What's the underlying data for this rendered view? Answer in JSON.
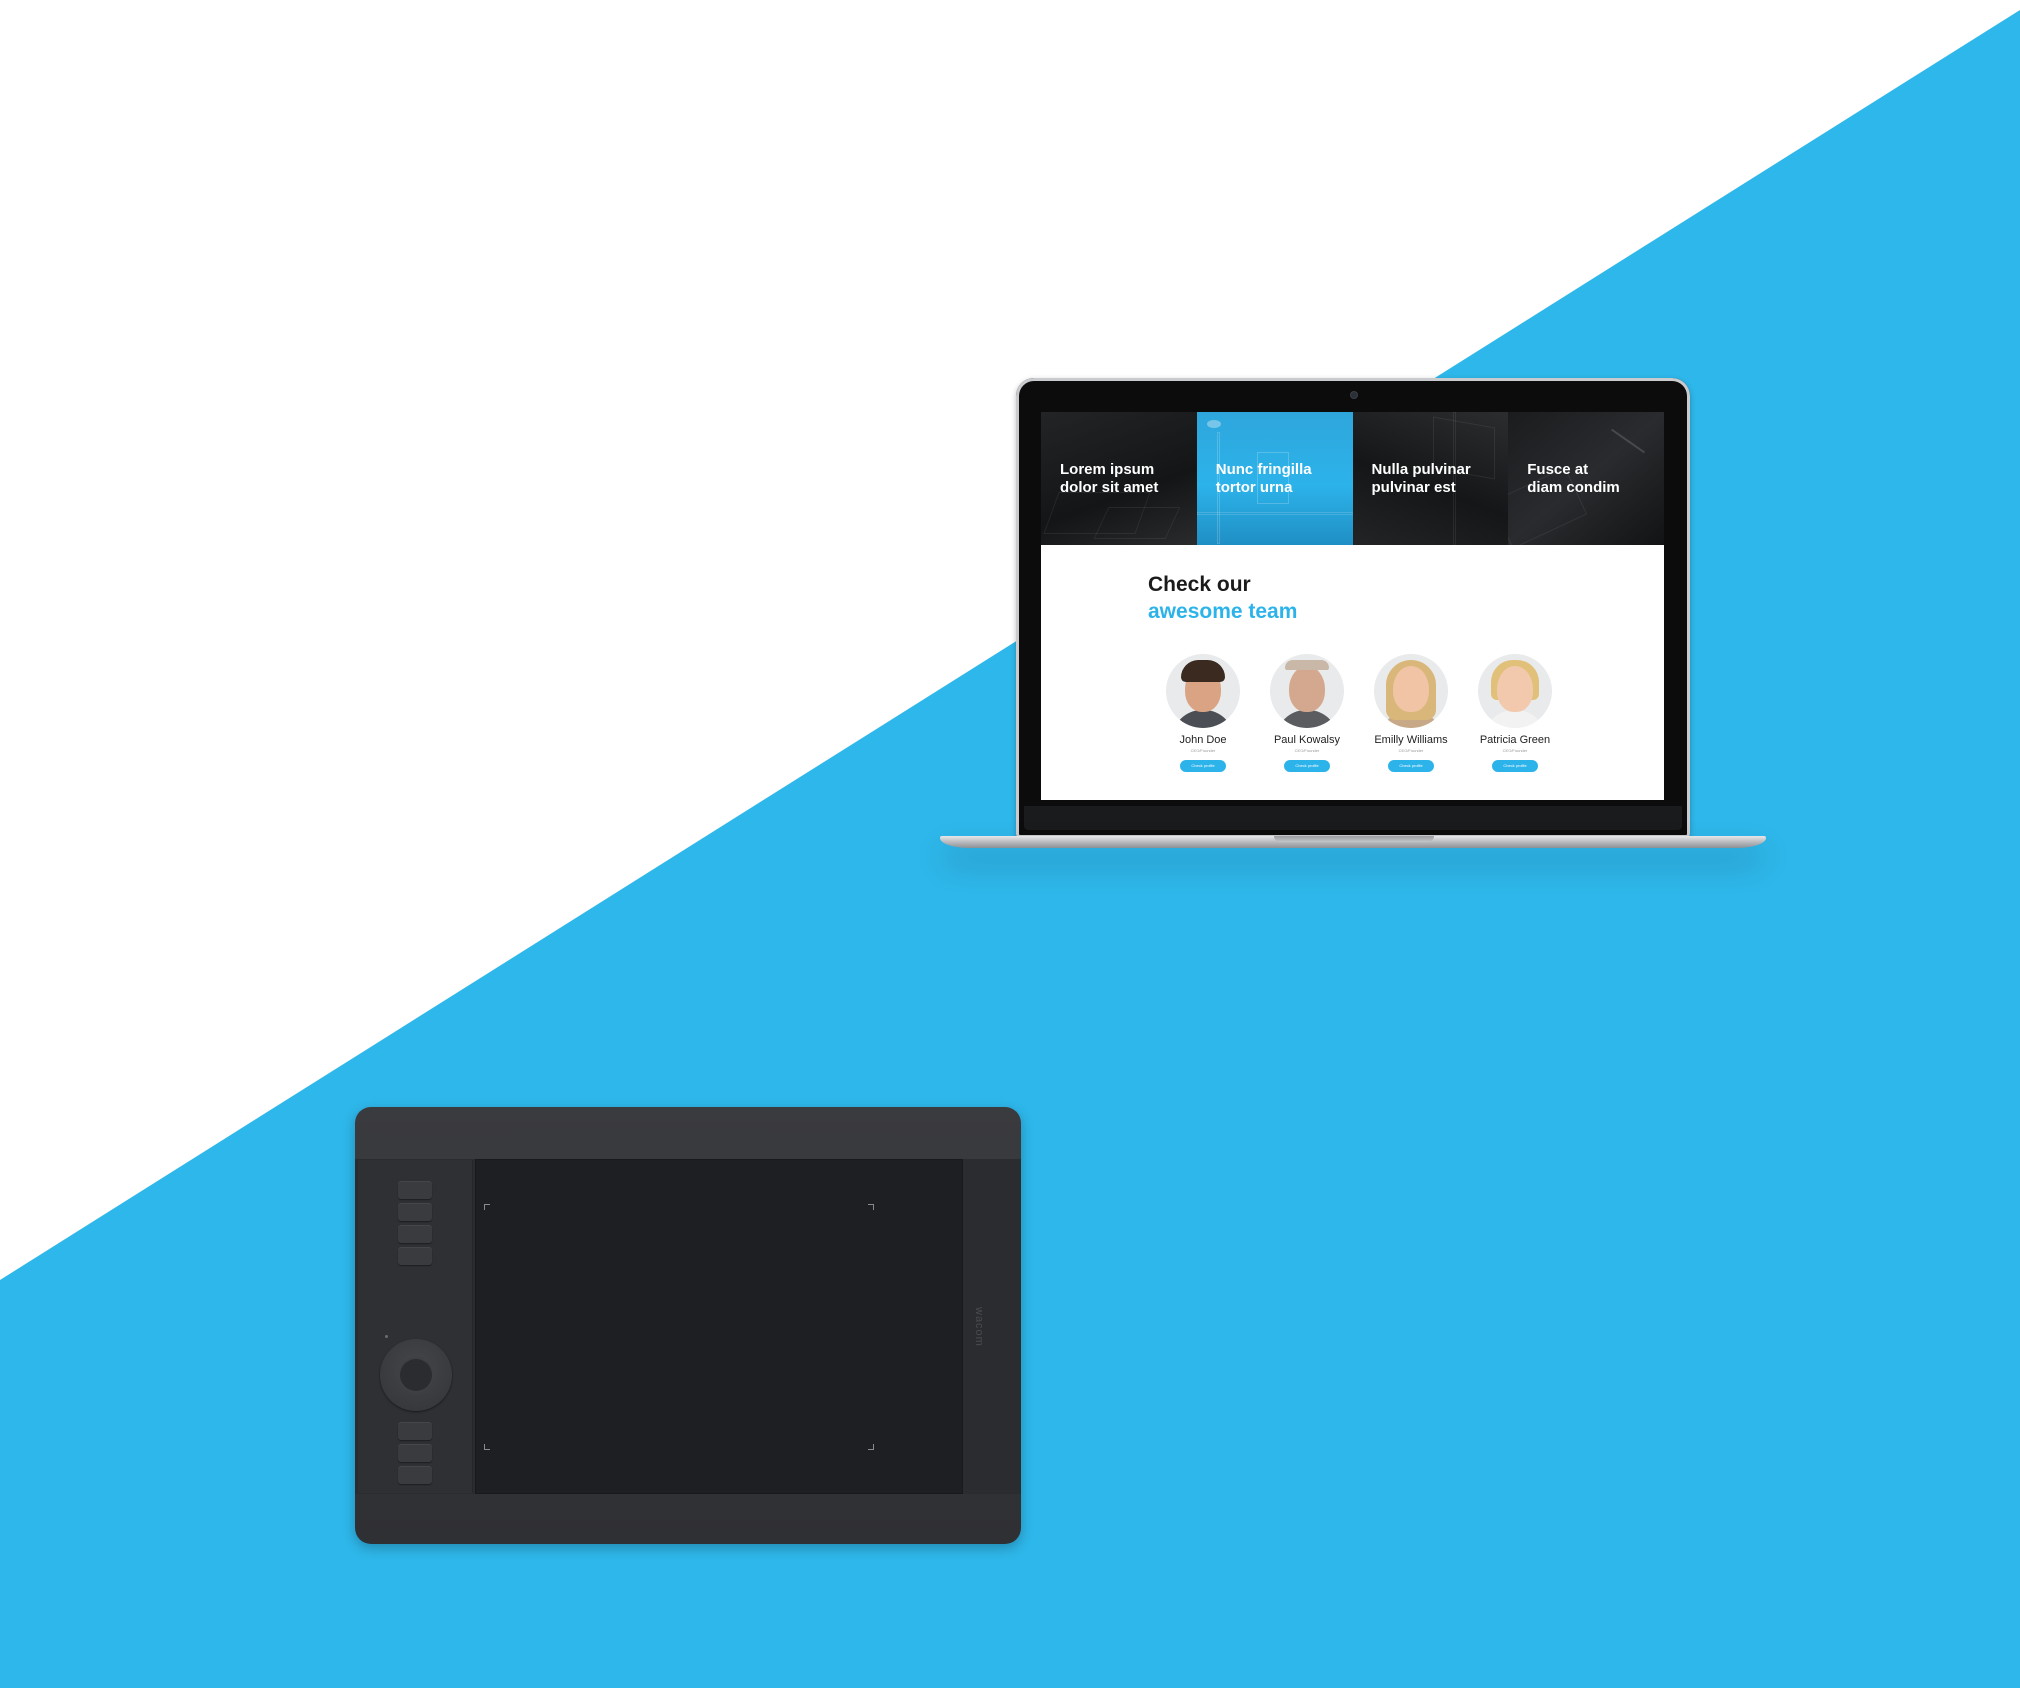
{
  "colors": {
    "accent": "#2cb3ea",
    "background_light": "#ffffff",
    "background_accent": "#2eb7ea",
    "heading_dark": "#1b1b1b"
  },
  "banner": {
    "tiles": [
      {
        "title": "Lorem ipsum\ndolor sit amet"
      },
      {
        "title": "Nunc fringilla\ntortor urna"
      },
      {
        "title": "Nulla pulvinar\npulvinar est"
      },
      {
        "title": "Fusce at\ndiam condim"
      }
    ]
  },
  "team": {
    "heading_line1": "Check our",
    "heading_line2": "awesome team",
    "members": [
      {
        "name": "John Doe",
        "role": "CEO/Founder",
        "button": "Check profile",
        "avatar_icon": "person-avatar-icon"
      },
      {
        "name": "Paul Kowalsy",
        "role": "CEO/Founder",
        "button": "Check profile",
        "avatar_icon": "person-avatar-icon"
      },
      {
        "name": "Emilly Williams",
        "role": "CEO/Founder",
        "button": "Check profile",
        "avatar_icon": "person-avatar-icon"
      },
      {
        "name": "Patricia Green",
        "role": "CEO/Founder",
        "button": "Check profile",
        "avatar_icon": "person-avatar-icon"
      }
    ]
  },
  "tablet": {
    "brand": "wacom"
  }
}
